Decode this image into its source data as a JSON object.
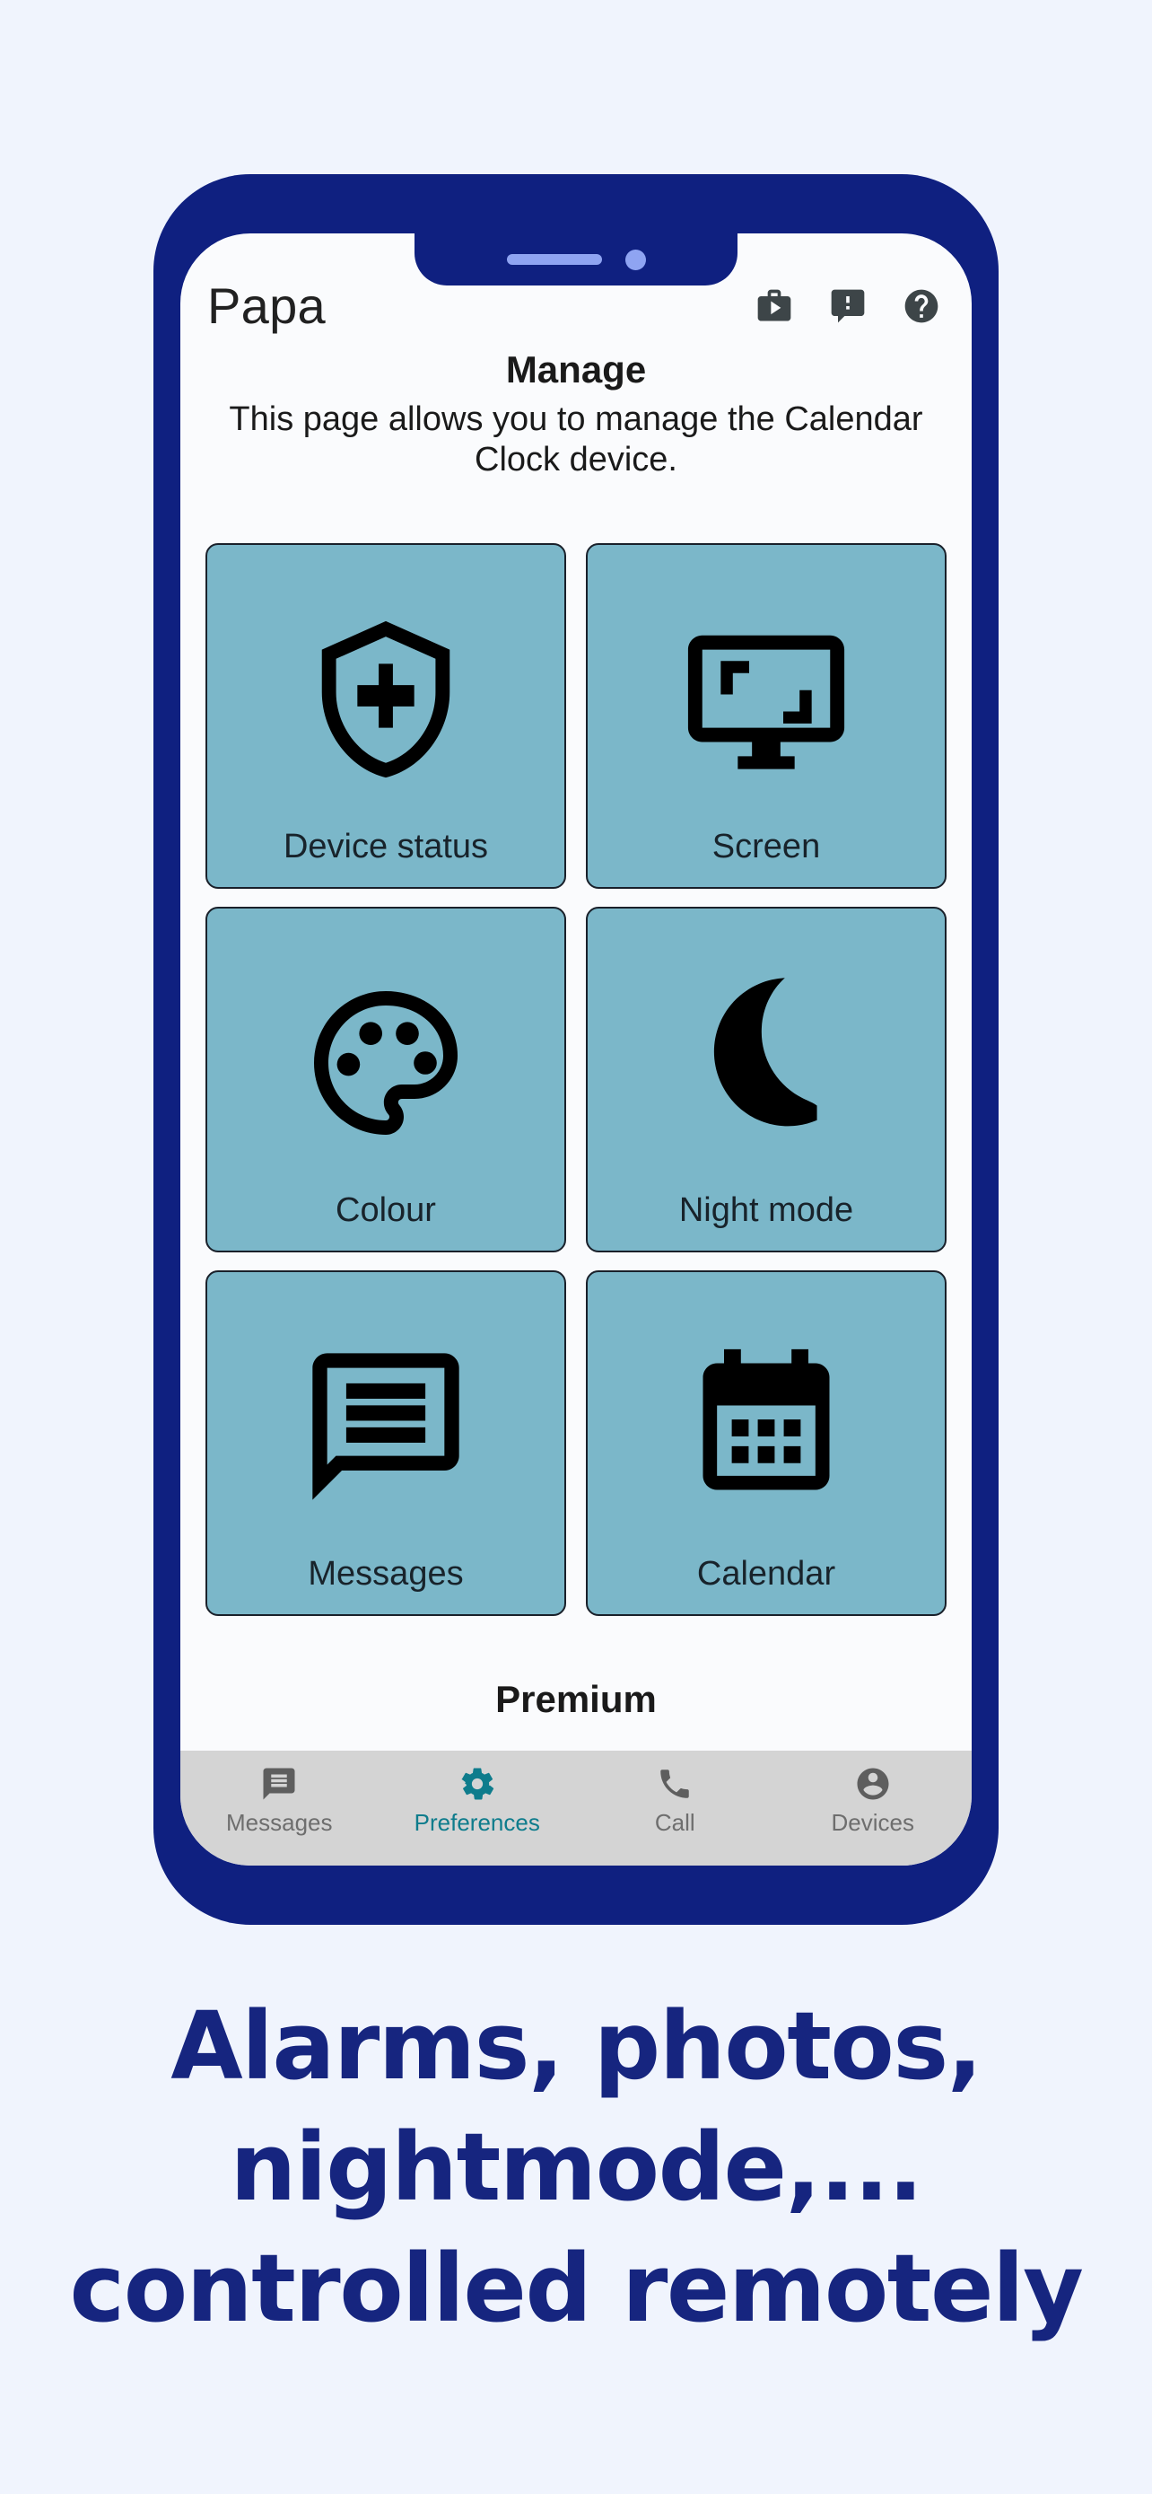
{
  "theme": {
    "page_background": "#f0f4fd",
    "phone_frame": "#0f2080",
    "screen_background": "#fafbfd",
    "tile_background": "#7bb7c9",
    "tile_border": "#19202a",
    "accent_active": "#0e7c8c",
    "nav_background": "#d4d4d4",
    "headline_color": "#16257f",
    "notch_detail": "#8fa4f2"
  },
  "phone": {
    "notch": {
      "speaker_icon": "speaker-bar",
      "camera_icon": "camera-dot"
    }
  },
  "header": {
    "title": "Papa",
    "actions": [
      {
        "name": "work-play-icon",
        "label": "Work"
      },
      {
        "name": "feedback-icon",
        "label": "Feedback"
      },
      {
        "name": "help-icon",
        "label": "Help"
      }
    ]
  },
  "page": {
    "heading": "Manage",
    "description": "This page allows you to manage the Calendar Clock device."
  },
  "tiles": [
    {
      "label": "Device status",
      "icon": "shield-plus-icon"
    },
    {
      "label": "Screen",
      "icon": "monitor-icon"
    },
    {
      "label": "Colour",
      "icon": "palette-icon"
    },
    {
      "label": "Night mode",
      "icon": "crescent-moon-icon"
    },
    {
      "label": "Messages",
      "icon": "speech-bubble-lines-icon"
    },
    {
      "label": "Calendar",
      "icon": "calendar-icon"
    }
  ],
  "premium": {
    "label": "Premium"
  },
  "bottom_nav": {
    "active_index": 1,
    "items": [
      {
        "label": "Messages",
        "icon": "message-icon"
      },
      {
        "label": "Preferences",
        "icon": "gear-icon"
      },
      {
        "label": "Call",
        "icon": "phone-icon"
      },
      {
        "label": "Devices",
        "icon": "account-icon"
      }
    ]
  },
  "marketing": {
    "line1": "Alarms, photos,",
    "line2": "nightmode,...",
    "line3": "controlled remotely"
  }
}
